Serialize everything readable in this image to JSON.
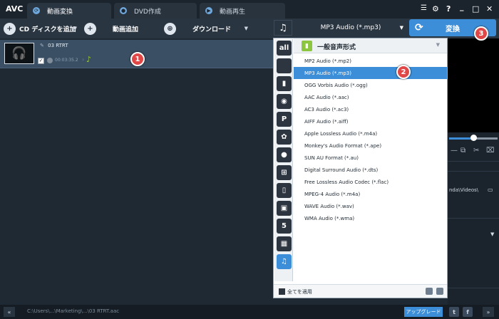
{
  "app": {
    "logo": "AVC",
    "tabs": [
      {
        "label": "動画変換",
        "icon": "refresh-icon",
        "active": true
      },
      {
        "label": "DVD作成",
        "icon": "disc-icon",
        "active": false
      },
      {
        "label": "動画再生",
        "icon": "play-icon",
        "active": false
      }
    ],
    "window_controls": [
      "list-icon",
      "gear-icon",
      "?",
      "_",
      "□",
      "✕"
    ]
  },
  "toolbar": {
    "cd_button": "CD ディスクを追加",
    "add_video_button": "動画追加",
    "download_button": "ダウンロード",
    "format_value": "MP3 Audio (*.mp3)",
    "convert_button": "変換"
  },
  "file": {
    "name": "03 RTRT",
    "checked": true,
    "duration": "00:03:35.2"
  },
  "format_menu": {
    "group_title": "一般音声形式",
    "categories": [
      "all-formats-icon",
      "apple-icon",
      "mobile-icon",
      "android-icon",
      "playstation-icon",
      "huawei-icon",
      "blackberry-icon",
      "windows-icon",
      "phone-icon",
      "tv-icon",
      "html5-icon",
      "film-icon",
      "music-icon"
    ],
    "items": [
      {
        "label": "MP2 Audio (*.mp2)",
        "selected": false
      },
      {
        "label": "MP3 Audio (*.mp3)",
        "selected": true
      },
      {
        "label": "OGG Vorbis Audio (*.ogg)",
        "selected": false
      },
      {
        "label": "AAC Audio (*.aac)",
        "selected": false
      },
      {
        "label": "AC3 Audio (*.ac3)",
        "selected": false
      },
      {
        "label": "AIFF Audio (*.aiff)",
        "selected": false
      },
      {
        "label": "Apple Lossless Audio (*.m4a)",
        "selected": false
      },
      {
        "label": "Monkey's Audio Format (*.ape)",
        "selected": false
      },
      {
        "label": "SUN AU Format (*.au)",
        "selected": false
      },
      {
        "label": "Digital Surround Audio (*.dts)",
        "selected": false
      },
      {
        "label": "Free Lossless Audio Codec (*.flac)",
        "selected": false
      },
      {
        "label": "MPEG-4 Audio (*.m4a)",
        "selected": false
      },
      {
        "label": "WAVE Audio (*.wav)",
        "selected": false
      },
      {
        "label": "WMA Audio (*.wma)",
        "selected": false
      }
    ],
    "apply_all": "全てを適用"
  },
  "right_panel": {
    "output_path": "nda\\Videos\\"
  },
  "status": {
    "path": "C:\\Users\\...\\Marketing\\...\\03 RTRT.aac",
    "upgrade_button": "アップグレード"
  },
  "callouts": [
    "1",
    "2",
    "3"
  ],
  "colors": {
    "accent": "#3d8ed8",
    "callout": "#e04848",
    "selected_row": "#3a4f63"
  }
}
